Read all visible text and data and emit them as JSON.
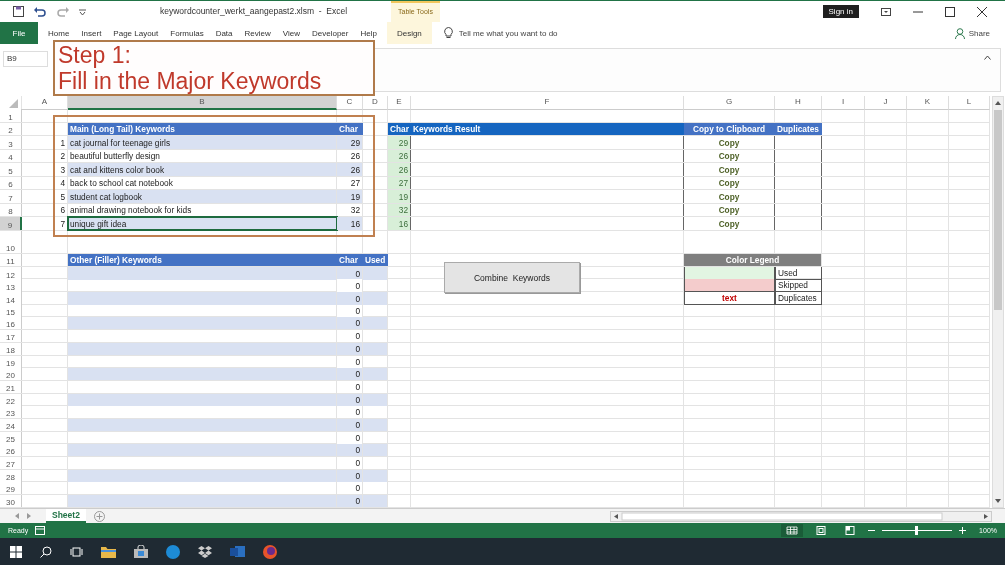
{
  "title_bar": {
    "file_title": "keywordcounter_werkt_aangepast2.xlsm  -  Excel",
    "context_label": "Table Tools",
    "sign_in": "Sign in"
  },
  "ribbon_tabs": [
    {
      "label": "File",
      "kind": "file"
    },
    {
      "label": "Home",
      "kind": "tab"
    },
    {
      "label": "Insert",
      "kind": "tab"
    },
    {
      "label": "Page Layout",
      "kind": "tab"
    },
    {
      "label": "Formulas",
      "kind": "tab"
    },
    {
      "label": "Data",
      "kind": "tab"
    },
    {
      "label": "Review",
      "kind": "tab"
    },
    {
      "label": "View",
      "kind": "tab"
    },
    {
      "label": "Developer",
      "kind": "tab"
    },
    {
      "label": "Help",
      "kind": "tab"
    },
    {
      "label": "Design",
      "kind": "contextual"
    }
  ],
  "tell_me": {
    "placeholder": "Tell me what you want to do"
  },
  "share": "Share",
  "name_box": "B9",
  "callout": {
    "lines": [
      "Step 1:",
      "Fill in the Major Keywords"
    ]
  },
  "column_headers": [
    "A",
    "B",
    "C",
    "D",
    "E",
    "F",
    "G",
    "H",
    "I",
    "J",
    "K",
    "L"
  ],
  "row_headers": [
    "1",
    "2",
    "3",
    "4",
    "5",
    "6",
    "7",
    "8",
    "9",
    "10",
    "11",
    "12",
    "13",
    "14",
    "15",
    "16",
    "17",
    "18",
    "19",
    "20",
    "21",
    "22",
    "23",
    "24",
    "25",
    "26",
    "27",
    "28",
    "29",
    "30"
  ],
  "main_keywords": {
    "columns": [
      "Main (Long Tail) Keywords",
      "Char"
    ],
    "rows": [
      {
        "number": "1",
        "keyword": "cat journal for teenage girls",
        "char": "29",
        "selected": false
      },
      {
        "number": "2",
        "keyword": "beautiful butterfly design",
        "char": "26",
        "selected": false
      },
      {
        "number": "3",
        "keyword": "cat and kittens color book",
        "char": "26",
        "selected": false
      },
      {
        "number": "4",
        "keyword": "back to school cat notebook",
        "char": "27",
        "selected": false
      },
      {
        "number": "5",
        "keyword": "student cat logbook",
        "char": "19",
        "selected": false
      },
      {
        "number": "6",
        "keyword": "animal drawing notebook for kids",
        "char": "32",
        "selected": false
      },
      {
        "number": "7",
        "keyword": "unique gift idea",
        "char": "16",
        "selected": true
      }
    ]
  },
  "results": {
    "columns": [
      "Char",
      "Keywords Result",
      "Copy to Clipboard",
      "Duplicates"
    ],
    "rows": [
      {
        "char": "29",
        "copy": "Copy"
      },
      {
        "char": "26",
        "copy": "Copy"
      },
      {
        "char": "26",
        "copy": "Copy"
      },
      {
        "char": "27",
        "copy": "Copy"
      },
      {
        "char": "19",
        "copy": "Copy"
      },
      {
        "char": "32",
        "copy": "Copy"
      },
      {
        "char": "16",
        "copy": "Copy"
      }
    ]
  },
  "filler_keywords": {
    "columns": [
      "Other (Filler) Keywords",
      "Char",
      "Used"
    ],
    "rows": [
      {
        "char": "0"
      },
      {
        "char": "0"
      },
      {
        "char": "0"
      },
      {
        "char": "0"
      },
      {
        "char": "0"
      },
      {
        "char": "0"
      },
      {
        "char": "0"
      },
      {
        "char": "0"
      },
      {
        "char": "0"
      },
      {
        "char": "0"
      },
      {
        "char": "0"
      },
      {
        "char": "0"
      },
      {
        "char": "0"
      },
      {
        "char": "0"
      },
      {
        "char": "0"
      },
      {
        "char": "0"
      },
      {
        "char": "0"
      },
      {
        "char": "0"
      },
      {
        "char": "0"
      }
    ]
  },
  "combine_button": "Combine  Keywords",
  "color_legend": {
    "title": "Color Legend",
    "items": [
      {
        "kind": "used",
        "label": "Used"
      },
      {
        "kind": "skipped",
        "label": "Skipped"
      },
      {
        "kind": "duplicates",
        "sample": "text",
        "label": "Duplicates"
      }
    ]
  },
  "sheet_tabs": [
    {
      "label": "Sheet2",
      "selected": true
    }
  ],
  "status_bar": {
    "status": "Ready",
    "zoom": {
      "level": 0.5,
      "reading": "100%"
    }
  }
}
